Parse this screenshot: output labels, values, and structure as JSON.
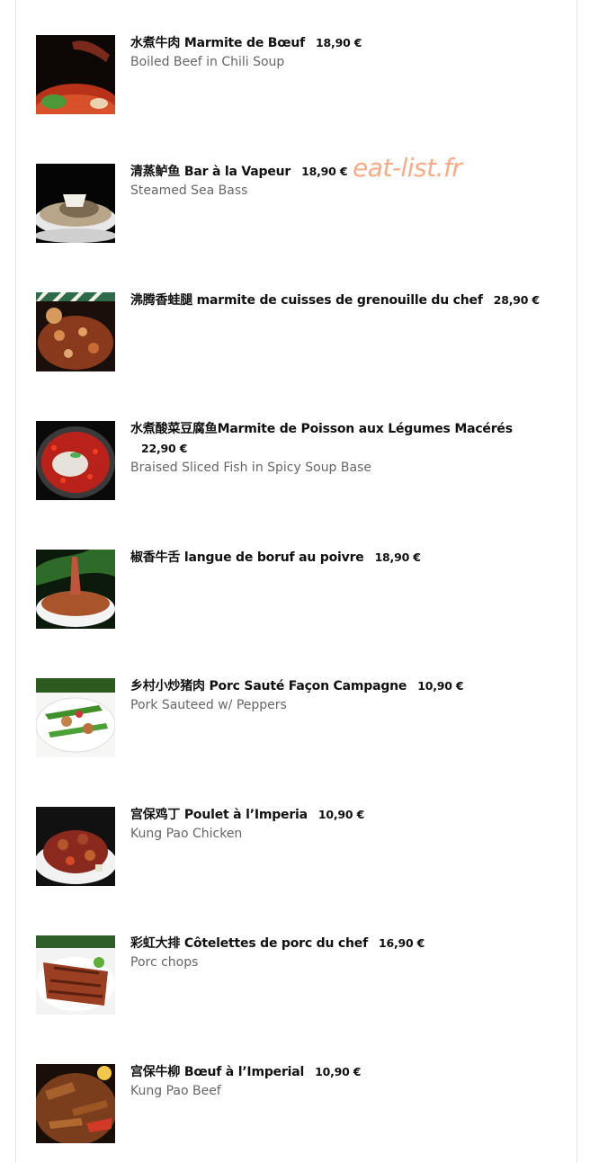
{
  "watermark": "eat-list.fr",
  "items": [
    {
      "title": "水煮牛肉 Marmite de Bœuf",
      "price": "18,90 €",
      "subtitle": "Boiled Beef in Chili Soup"
    },
    {
      "title": "清蒸鲈鱼 Bar à la Vapeur",
      "price": "18,90 €",
      "subtitle": "Steamed Sea Bass"
    },
    {
      "title": "沸腾香蛙腿 marmite de cuisses de grenouille du chef",
      "price": "28,90 €",
      "subtitle": ""
    },
    {
      "title": "水煮酸菜豆腐鱼Marmite de Poisson aux Légumes Macérés",
      "price": "22,90 €",
      "subtitle": "Braised Sliced Fish in Spicy Soup Base"
    },
    {
      "title": "椒香牛舌 langue de boruf au poivre",
      "price": "18,90 €",
      "subtitle": ""
    },
    {
      "title": "乡村小炒猪肉 Porc Sauté Façon Campagne",
      "price": "10,90 €",
      "subtitle": "Pork Sauteed w/ Peppers"
    },
    {
      "title": "宫保鸡丁 Poulet à l’Imperia",
      "price": "10,90 €",
      "subtitle": "Kung Pao Chicken"
    },
    {
      "title": "彩虹大排 Côtelettes de porc du chef",
      "price": "16,90 €",
      "subtitle": "Porc chops"
    },
    {
      "title": "宫保牛柳 Bœuf à l’Imperial",
      "price": "10,90 €",
      "subtitle": "Kung Pao Beef"
    }
  ]
}
